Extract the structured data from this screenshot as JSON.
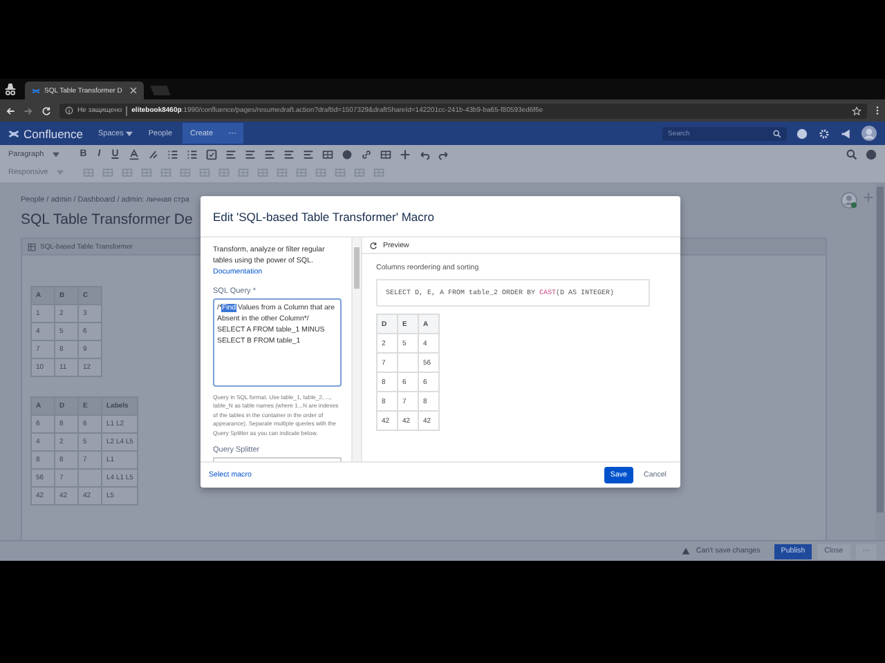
{
  "browser": {
    "tab_title": "SQL Table Transformer D",
    "security_label": "Не защищено",
    "url_host": "elitebook8460p",
    "url_path": ":1990/confluence/pages/resumedraft.action?draftId=1507329&draftShareId=142201cc-241b-43b9-ba65-f80593ed6f6e"
  },
  "nav": {
    "logo": "Confluence",
    "items": [
      {
        "label": "Spaces",
        "dropdown": true
      },
      {
        "label": "People",
        "dropdown": false
      }
    ],
    "create": "Create",
    "more": "···",
    "search": {
      "placeholder": "Search"
    }
  },
  "toolbar": {
    "style_select": "Paragraph",
    "format_buttons": [
      "B",
      "I",
      "U"
    ],
    "layout_select": {
      "label": "Responsive",
      "disabled": true
    }
  },
  "breadcrumb": "People / admin / Dashboard / admin: личная стра",
  "page_title": "SQL Table Transformer De",
  "macro": {
    "title": "SQL-based Table Transformer",
    "tables": [
      {
        "columns": [
          "A",
          "B",
          "C"
        ],
        "rows": [
          [
            "1",
            "2",
            "3"
          ],
          [
            "4",
            "5",
            "6"
          ],
          [
            "7",
            "8",
            "9"
          ],
          [
            "10",
            "11",
            "12"
          ]
        ]
      },
      {
        "columns": [
          "A",
          "D",
          "E",
          "Labels"
        ],
        "rows": [
          [
            "6",
            "8",
            "6",
            "L1 L2"
          ],
          [
            "4",
            "2",
            "5",
            "L2 L4 L5"
          ],
          [
            "8",
            "8",
            "7",
            "L1"
          ],
          [
            "56",
            "7",
            "",
            "L4 L1 L5"
          ],
          [
            "42",
            "42",
            "42",
            "L5"
          ]
        ]
      }
    ]
  },
  "dialog": {
    "title": "Edit 'SQL-based Table Transformer' Macro",
    "description": "Transform, analyze or filter regular tables using the power of SQL.",
    "doc_link": "Documentation",
    "query_label": "SQL Query *",
    "query": {
      "before": "/*",
      "selected": "Find",
      "after": " Values from a Column that are Absent in the other Column*/\nSELECT A FROM table_1 MINUS\nSELECT B FROM table_1"
    },
    "query_hint": "Query in SQL format. Use table_1, table_2, ..., table_N as table names (where 1...N are indexes of the tables in the container in the order of appearance). Separate multiple queries with the Query Splitter as you can indicate below.",
    "splitter_label": "Query Splitter",
    "preview": {
      "label": "Preview",
      "caption": "Columns reordering and sorting",
      "code": [
        {
          "text": "SELECT D, E, A FROM table_2 ORDER BY ",
          "kind": "plain"
        },
        {
          "text": "CAST",
          "kind": "function"
        },
        {
          "text": "(D AS INTEGER)",
          "kind": "plain"
        }
      ],
      "table": {
        "columns": [
          "D",
          "E",
          "A"
        ],
        "rows": [
          [
            "2",
            "5",
            "4"
          ],
          [
            "7",
            "",
            "56"
          ],
          [
            "8",
            "6",
            "6"
          ],
          [
            "8",
            "7",
            "8"
          ],
          [
            "42",
            "42",
            "42"
          ]
        ]
      }
    },
    "footer_link": "Select macro",
    "buttons": [
      {
        "label": "Save",
        "primary": true
      },
      {
        "label": "Cancel",
        "primary": false
      }
    ]
  },
  "status_bar": {
    "warning": "Can't save changes",
    "publish": "Publish",
    "close": "Close",
    "more": "···"
  }
}
